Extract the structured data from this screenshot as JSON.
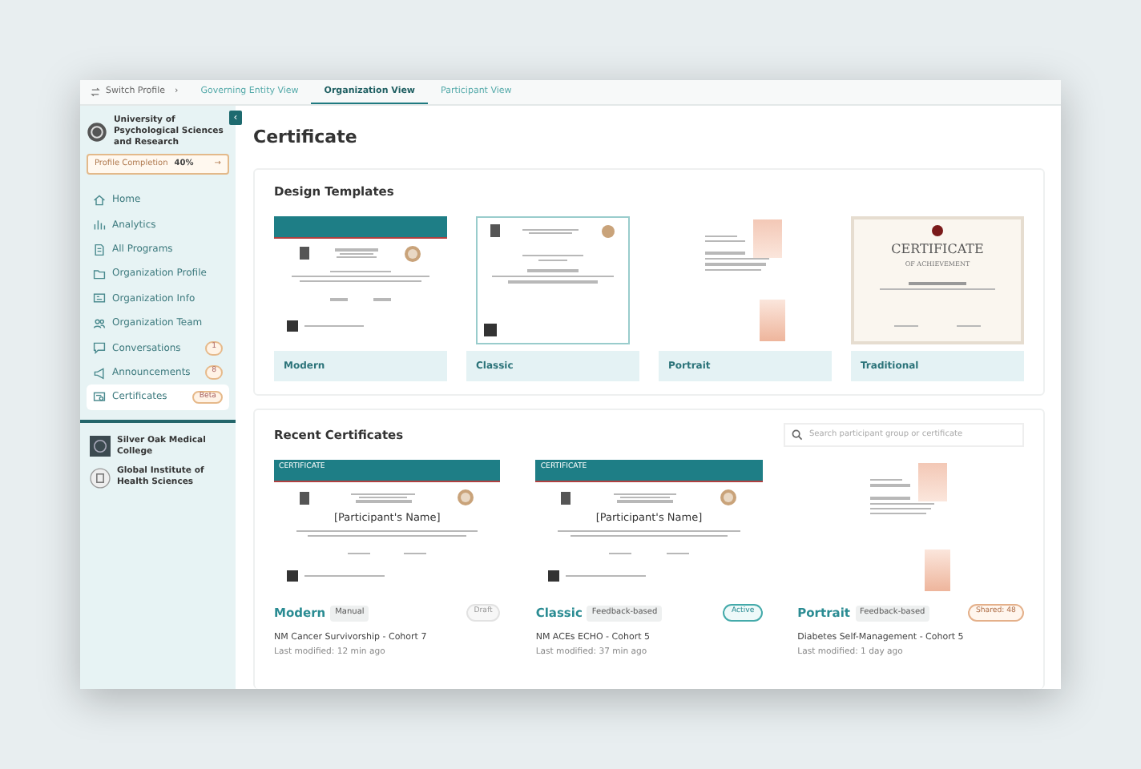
{
  "top_nav": {
    "switch_profile": "Switch Profile",
    "separator": "›",
    "tabs": [
      {
        "label": "Governing Entity View",
        "selected": false
      },
      {
        "label": "Organization View",
        "selected": true
      },
      {
        "label": "Participant View",
        "selected": false
      }
    ]
  },
  "sidebar": {
    "collapse_button": "‹",
    "organization": {
      "name": "University of Psychological Sciences and Research"
    },
    "profile_completion": {
      "label": "Profile Completion",
      "value": "40%",
      "arrow": "→"
    },
    "items": [
      {
        "label": "Home",
        "selected": false
      },
      {
        "label": "Analytics",
        "selected": false
      },
      {
        "label": "All Programs",
        "selected": false
      },
      {
        "label": "Organization Profile",
        "selected": false
      },
      {
        "label": "Organization Info",
        "selected": false
      },
      {
        "label": "Organization Team",
        "selected": false
      },
      {
        "label": "Conversations",
        "badge": "1",
        "selected": false
      },
      {
        "label": "Announcements",
        "badge": "8",
        "selected": false
      },
      {
        "label": "Certificates",
        "badge": "Beta",
        "selected": true
      }
    ],
    "other_organizations": [
      {
        "name": "Silver Oak Medical College",
        "kind": "square"
      },
      {
        "name": "Global Institute of Health Sciences",
        "kind": "round"
      }
    ]
  },
  "page_title": "Certificate",
  "design_templates": {
    "title": "Design Templates",
    "items": [
      {
        "label": "Modern",
        "kind": "modern"
      },
      {
        "label": "Classic",
        "kind": "classic"
      },
      {
        "label": "Portrait",
        "kind": "portrait"
      },
      {
        "label": "Traditional",
        "kind": "traditional",
        "preview": {
          "heading": "CERTIFICATE",
          "subheading": "OF ACHIEVEMENT"
        }
      }
    ]
  },
  "recent_certificates": {
    "title": "Recent Certificates",
    "search": {
      "placeholder": "Search participant group or certificate"
    },
    "items": [
      {
        "template": "Modern",
        "kind": "modern",
        "type": "Manual",
        "status": {
          "label": "Draft",
          "kind": "draft"
        },
        "cohort": "NM Cancer Survivorship - Cohort 7",
        "modified": "Last modified: 12 min ago",
        "preview": {
          "heading": "CERTIFICATE",
          "name": "[Participant's Name]"
        }
      },
      {
        "template": "Classic",
        "kind": "modern",
        "type": "Feedback-based",
        "status": {
          "label": "Active",
          "kind": "active"
        },
        "cohort": "NM ACEs ECHO - Cohort 5",
        "modified": "Last modified: 37 min ago",
        "preview": {
          "heading": "CERTIFICATE",
          "name": "[Participant's Name]"
        }
      },
      {
        "template": "Portrait",
        "kind": "portrait",
        "type": "Feedback-based",
        "status": {
          "label": "Shared: 48",
          "kind": "shared"
        },
        "cohort": "Diabetes Self-Management - Cohort 5",
        "modified": "Last modified: 1 day ago"
      }
    ]
  }
}
